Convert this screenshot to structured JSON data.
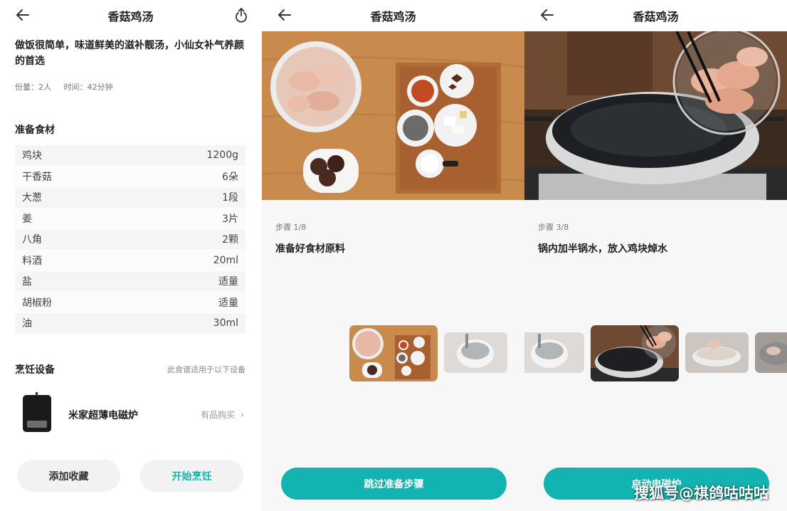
{
  "colors": {
    "accent": "#12b3b0",
    "text": "#222222",
    "muted": "#777777",
    "row_bg": "#f5f5f5"
  },
  "recipe": {
    "title": "香菇鸡汤",
    "headline": "做饭很简单，味道鲜美的滋补靓汤，小仙女补气养颜的首选",
    "servings": "份量：2人",
    "time": "时间：42分钟"
  },
  "ingredients": {
    "title": "准备食材",
    "items": [
      {
        "name": "鸡块",
        "amount": "1200g"
      },
      {
        "name": "干香菇",
        "amount": "6朵"
      },
      {
        "name": "大葱",
        "amount": "1段"
      },
      {
        "name": "姜",
        "amount": "3片"
      },
      {
        "name": "八角",
        "amount": "2颗"
      },
      {
        "name": "料酒",
        "amount": "20ml"
      },
      {
        "name": "盐",
        "amount": "适量"
      },
      {
        "name": "胡椒粉",
        "amount": "适量"
      },
      {
        "name": "油",
        "amount": "30ml"
      }
    ]
  },
  "device": {
    "title": "烹饪设备",
    "note": "此食谱适用于以下设备",
    "name": "米家超薄电磁炉",
    "buy": "有品购买"
  },
  "actions": {
    "favorite": "添加收藏",
    "start": "开始烹饪"
  },
  "steps": [
    {
      "label": "步骤 1/8",
      "text": "准备好食材原料",
      "cta": "跳过准备步骤"
    },
    {
      "label": "步骤 3/8",
      "text": "锅内加半锅水，放入鸡块焯水",
      "cta": "启动电磁炉"
    }
  ],
  "icons": {
    "back": "arrow-left-icon",
    "share": "share-icon",
    "chevron": "chevron-right-icon"
  },
  "watermark": "搜狐号@祺鸽咕咕咕"
}
